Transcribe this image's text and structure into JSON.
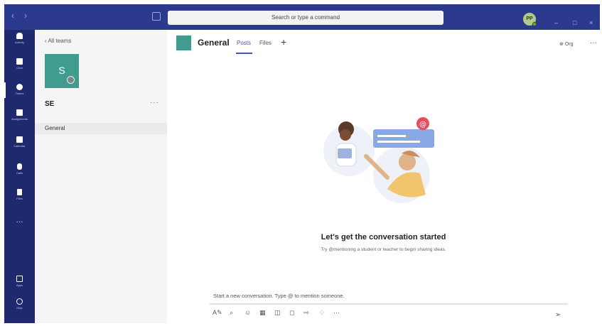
{
  "topbar": {
    "back_glyph": "‹",
    "forward_glyph": "›",
    "search_placeholder": "Search or type a command",
    "avatar_initials": "PP",
    "minimize_glyph": "–",
    "maximize_glyph": "□",
    "close_glyph": "×"
  },
  "appbar": {
    "items": [
      {
        "label": "Activity",
        "icon": "bell-icon"
      },
      {
        "label": "Chat",
        "icon": "chat-icon"
      },
      {
        "label": "Teams",
        "icon": "teams-icon"
      },
      {
        "label": "Assignments",
        "icon": "assignments-icon"
      },
      {
        "label": "Calendar",
        "icon": "calendar-icon"
      },
      {
        "label": "Calls",
        "icon": "phone-icon"
      },
      {
        "label": "Files",
        "icon": "file-icon"
      }
    ],
    "more_glyph": "···",
    "bottom_items": [
      {
        "label": "Apps",
        "icon": "apps-icon"
      },
      {
        "label": "Help",
        "icon": "help-icon"
      }
    ]
  },
  "teams_panel": {
    "back_label": "‹  All teams",
    "tile_letter": "S",
    "team_name": "SE",
    "more_glyph": "···",
    "channels": [
      "General"
    ]
  },
  "main": {
    "channel_title": "General",
    "tabs": [
      "Posts",
      "Files"
    ],
    "add_tab_glyph": "+",
    "org_label": "Org",
    "more_glyph": "···",
    "empty_title": "Let's get the conversation started",
    "empty_subtitle": "Try @mentioning a student or teacher to begin sharing ideas.",
    "composer_placeholder": "Start a new conversation. Type @ to mention someone.",
    "tool_glyphs": [
      "A✎",
      "⌕",
      "☺",
      "▦",
      "◫",
      "◻",
      "⇨",
      "♢",
      "···"
    ],
    "send_glyph": "➢"
  },
  "colors": {
    "topbar": "#2b3a8c",
    "appbar": "#1f2a6e",
    "accent": "#4b55a8",
    "team_tile": "#3f9c8e"
  }
}
